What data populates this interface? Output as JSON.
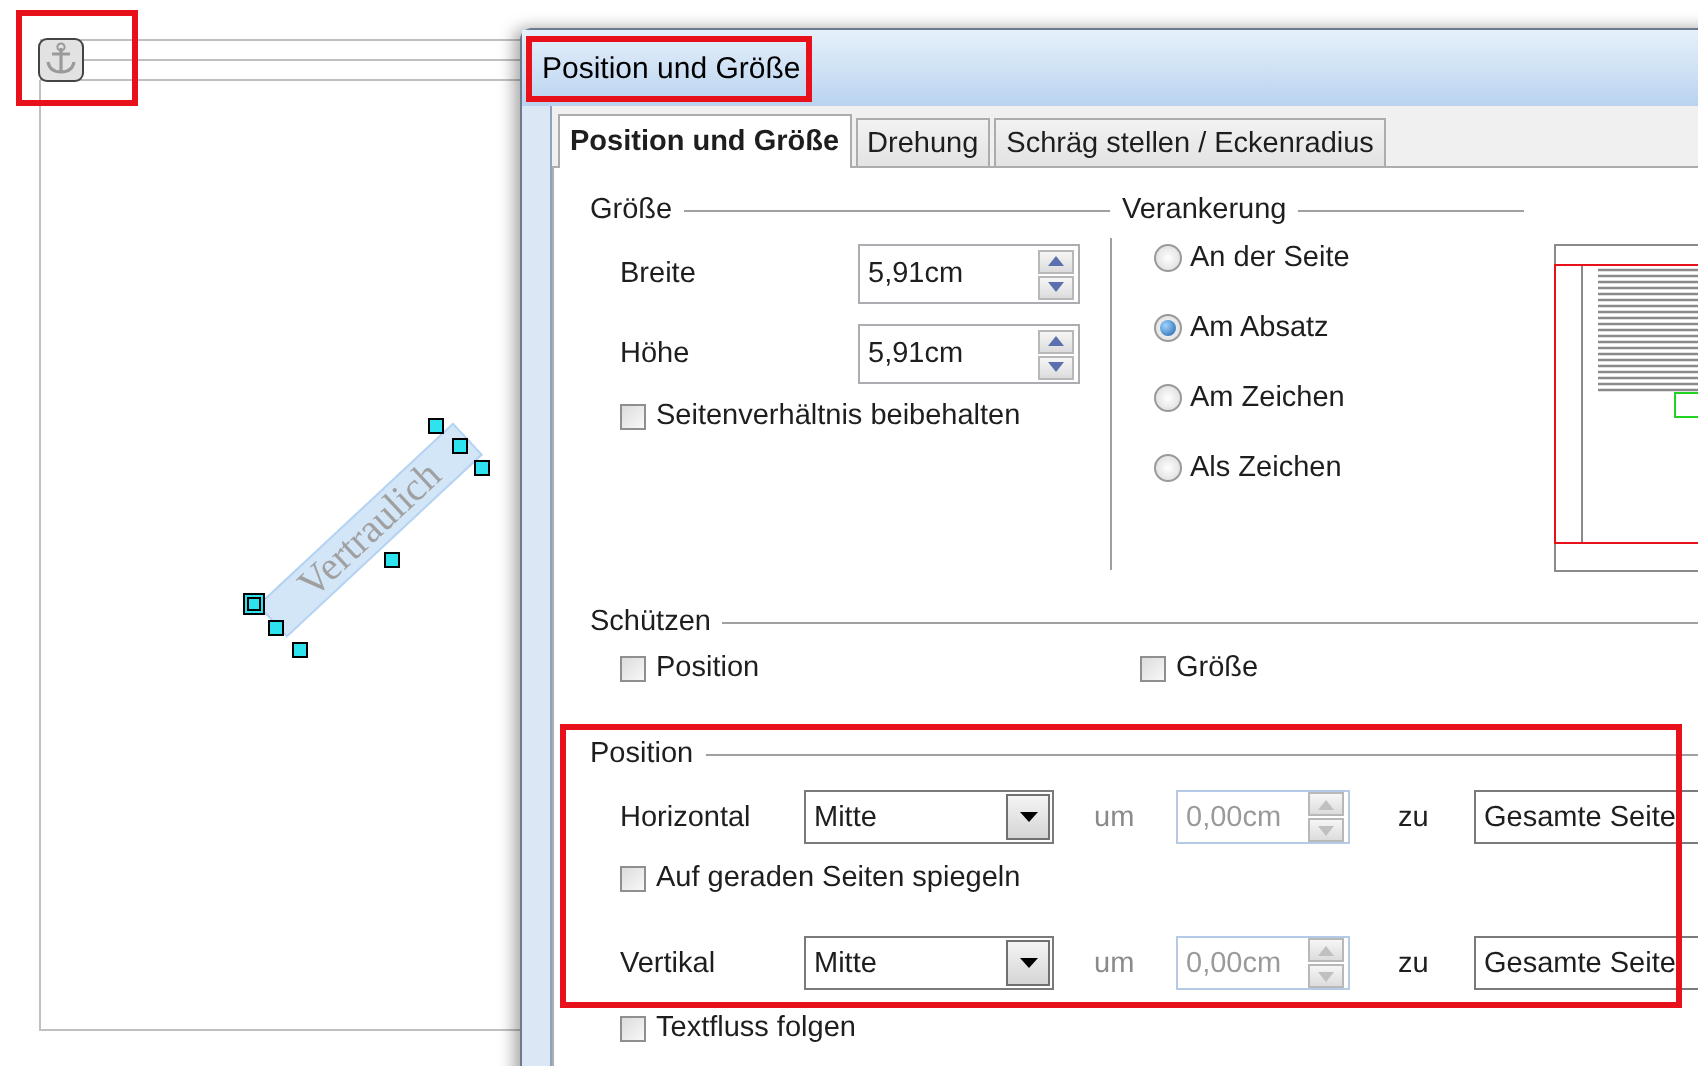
{
  "document": {
    "watermark": "Vertraulich"
  },
  "dialog": {
    "title": "Position und Größe",
    "tabs": [
      {
        "label": "Position und Größe",
        "selected": true
      },
      {
        "label": "Drehung",
        "selected": false
      },
      {
        "label": "Schräg stellen / Eckenradius",
        "selected": false
      }
    ],
    "size": {
      "heading": "Größe",
      "fields": [
        {
          "label": "Breite",
          "value": "5,91cm"
        },
        {
          "label": "Höhe",
          "value": "5,91cm"
        }
      ],
      "keep_ratio": {
        "label": "Seitenverhältnis beibehalten",
        "checked": false
      }
    },
    "anchor": {
      "heading": "Verankerung",
      "options": [
        {
          "label": "An der Seite",
          "selected": false
        },
        {
          "label": "Am Absatz",
          "selected": true
        },
        {
          "label": "Am Zeichen",
          "selected": false
        },
        {
          "label": "Als Zeichen",
          "selected": false
        }
      ]
    },
    "protect": {
      "heading": "Schützen",
      "options": [
        {
          "label": "Position",
          "checked": false
        },
        {
          "label": "Größe",
          "checked": false
        }
      ]
    },
    "position": {
      "heading": "Position",
      "items": [
        {
          "kind": "row",
          "label": "Horizontal",
          "value": "Mitte",
          "by_label": "um",
          "by_value": "0,00cm",
          "by_disabled": true,
          "to_label": "zu",
          "to_value": "Gesamte Seite"
        },
        {
          "kind": "checkbox",
          "label": "Auf geraden Seiten spiegeln",
          "checked": false
        },
        {
          "kind": "row",
          "label": "Vertikal",
          "value": "Mitte",
          "by_label": "um",
          "by_value": "0,00cm",
          "by_disabled": true,
          "to_label": "zu",
          "to_value": "Gesamte Seite"
        },
        {
          "kind": "checkbox",
          "label": "Textfluss folgen",
          "checked": false
        }
      ]
    }
  }
}
